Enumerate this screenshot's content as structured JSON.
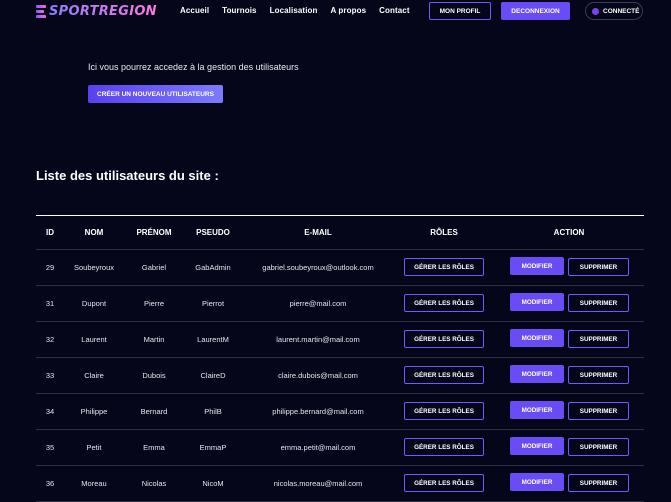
{
  "header": {
    "logo_text": "SPORTREGION",
    "nav": [
      "Accueil",
      "Tournois",
      "Localisation",
      "A propos",
      "Contact"
    ],
    "profile_button": "MON PROFIL",
    "logout_button": "DECONNEXION",
    "status_label": "CONNECTÉ"
  },
  "intro": {
    "text": "Ici vous pourrez accedez à la gestion des utilisateurs",
    "create_button": "CRÉER UN NOUVEAU UTILISATEURS"
  },
  "section_title": "Liste des utilisateurs du site :",
  "table": {
    "headers": [
      "ID",
      "NOM",
      "PRÉNOM",
      "PSEUDO",
      "E-MAIL",
      "RÔLES",
      "ACTION"
    ],
    "roles_button": "GÉRER LES RÔLES",
    "edit_button": "MODIFIER",
    "delete_button": "SUPPRIMER",
    "rows": [
      {
        "id": "29",
        "nom": "Soubeyroux",
        "prenom": "Gabriel",
        "pseudo": "GabAdmin",
        "email": "gabriel.soubeyroux@outlook.com"
      },
      {
        "id": "31",
        "nom": "Dupont",
        "prenom": "Pierre",
        "pseudo": "Pierrot",
        "email": "pierre@mail.com"
      },
      {
        "id": "32",
        "nom": "Laurent",
        "prenom": "Martin",
        "pseudo": "LaurentM",
        "email": "laurent.martin@mail.com"
      },
      {
        "id": "33",
        "nom": "Claire",
        "prenom": "Dubois",
        "pseudo": "ClaireD",
        "email": "claire.dubois@mail.com"
      },
      {
        "id": "34",
        "nom": "Philippe",
        "prenom": "Bernard",
        "pseudo": "PhilB",
        "email": "philippe.bernard@mail.com"
      },
      {
        "id": "35",
        "nom": "Petit",
        "prenom": "Emma",
        "pseudo": "EmmaP",
        "email": "emma.petit@mail.com"
      },
      {
        "id": "36",
        "nom": "Moreau",
        "prenom": "Nicolas",
        "pseudo": "NicoM",
        "email": "nicolas.moreau@mail.com"
      }
    ]
  },
  "colors": {
    "background": "#06061a",
    "accent": "#6a4cf5",
    "border_accent": "#6a5cff"
  }
}
